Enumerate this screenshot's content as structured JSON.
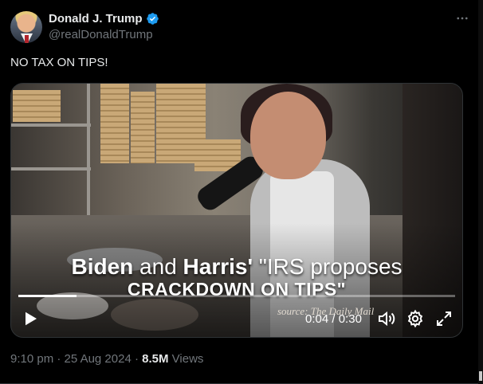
{
  "author": {
    "display_name": "Donald J. Trump",
    "handle": "@realDonaldTrump",
    "verified_icon": "verified-badge-icon",
    "verified_color": "#1d9bf0"
  },
  "more_icon": "more-horizontal-icon",
  "tweet": {
    "text": "NO TAX ON TIPS!"
  },
  "video": {
    "caption_line1_a": "Biden",
    "caption_line1_b": " and ",
    "caption_line1_c": "Harris'",
    "caption_line1_d": " \"IRS proposes",
    "caption_line2": "CRACKDOWN ON TIPS\"",
    "source": "source: The Daily Mail",
    "time_current": "0:04",
    "time_separator": " / ",
    "time_total": "0:30",
    "progress_fraction": 0.134,
    "icons": [
      "play-icon",
      "volume-icon",
      "settings-icon",
      "fullscreen-icon"
    ]
  },
  "meta": {
    "time": "9:10 pm",
    "sep1": " · ",
    "date": "25 Aug 2024",
    "sep2": " · ",
    "views_count": "8.5M",
    "views_label": " Views"
  }
}
